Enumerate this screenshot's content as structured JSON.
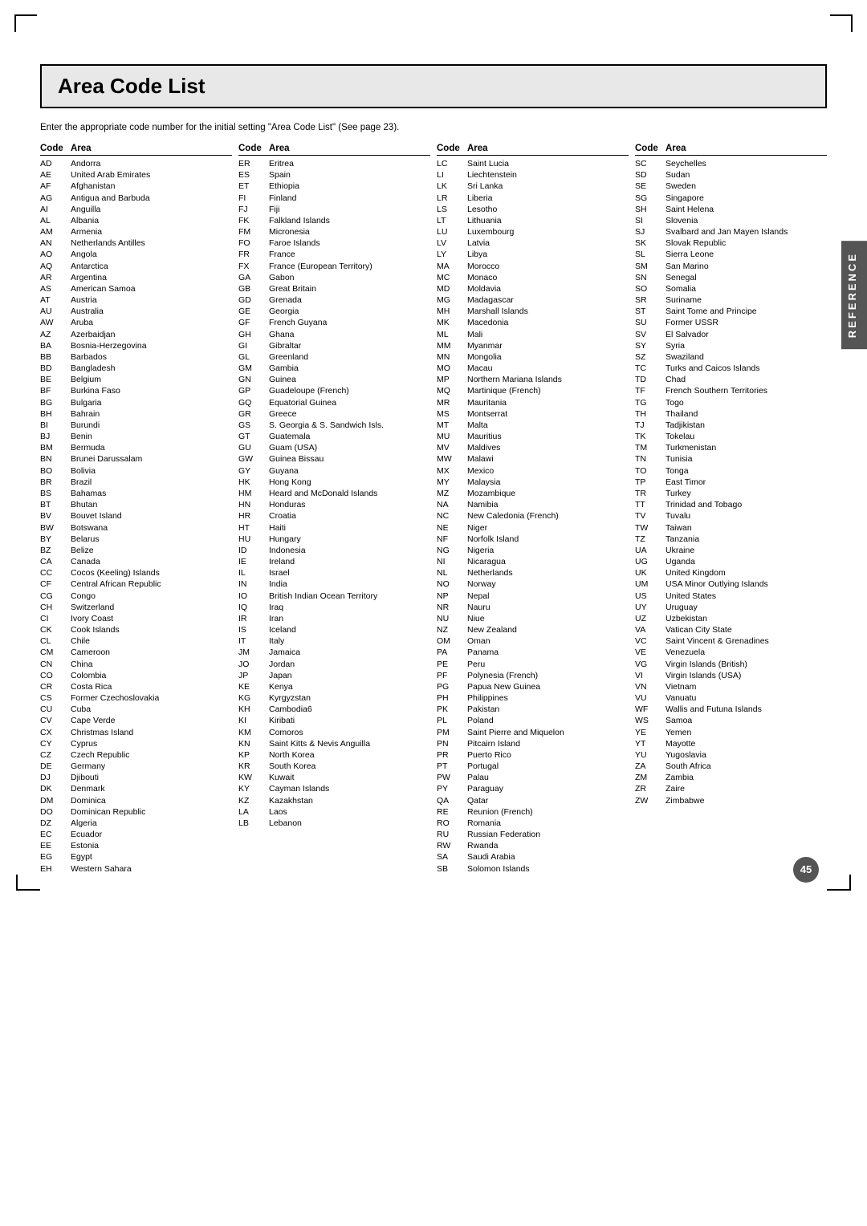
{
  "page": {
    "title": "Area Code List",
    "subtitle": "Enter the appropriate code number for the initial setting \"Area Code List\" (See page 23).",
    "page_number": "45",
    "side_tab": "REFERENCE"
  },
  "columns": [
    {
      "header_code": "Code",
      "header_area": "Area",
      "entries": [
        {
          "code": "AD",
          "area": "Andorra"
        },
        {
          "code": "AE",
          "area": "United Arab Emirates"
        },
        {
          "code": "AF",
          "area": "Afghanistan"
        },
        {
          "code": "AG",
          "area": "Antigua and Barbuda"
        },
        {
          "code": "AI",
          "area": "Anguilla"
        },
        {
          "code": "AL",
          "area": "Albania"
        },
        {
          "code": "AM",
          "area": "Armenia"
        },
        {
          "code": "AN",
          "area": "Netherlands Antilles"
        },
        {
          "code": "AO",
          "area": "Angola"
        },
        {
          "code": "AQ",
          "area": "Antarctica"
        },
        {
          "code": "AR",
          "area": "Argentina"
        },
        {
          "code": "AS",
          "area": "American Samoa"
        },
        {
          "code": "AT",
          "area": "Austria"
        },
        {
          "code": "AU",
          "area": "Australia"
        },
        {
          "code": "AW",
          "area": "Aruba"
        },
        {
          "code": "AZ",
          "area": "Azerbaidjan"
        },
        {
          "code": "BA",
          "area": "Bosnia-Herzegovina"
        },
        {
          "code": "BB",
          "area": "Barbados"
        },
        {
          "code": "BD",
          "area": "Bangladesh"
        },
        {
          "code": "BE",
          "area": "Belgium"
        },
        {
          "code": "BF",
          "area": "Burkina Faso"
        },
        {
          "code": "BG",
          "area": "Bulgaria"
        },
        {
          "code": "BH",
          "area": "Bahrain"
        },
        {
          "code": "BI",
          "area": "Burundi"
        },
        {
          "code": "BJ",
          "area": "Benin"
        },
        {
          "code": "BM",
          "area": "Bermuda"
        },
        {
          "code": "BN",
          "area": "Brunei Darussalam"
        },
        {
          "code": "BO",
          "area": "Bolivia"
        },
        {
          "code": "BR",
          "area": "Brazil"
        },
        {
          "code": "BS",
          "area": "Bahamas"
        },
        {
          "code": "BT",
          "area": "Bhutan"
        },
        {
          "code": "BV",
          "area": "Bouvet Island"
        },
        {
          "code": "BW",
          "area": "Botswana"
        },
        {
          "code": "BY",
          "area": "Belarus"
        },
        {
          "code": "BZ",
          "area": "Belize"
        },
        {
          "code": "CA",
          "area": "Canada"
        },
        {
          "code": "CC",
          "area": "Cocos (Keeling) Islands"
        },
        {
          "code": "CF",
          "area": "Central African Republic"
        },
        {
          "code": "CG",
          "area": "Congo"
        },
        {
          "code": "CH",
          "area": "Switzerland"
        },
        {
          "code": "CI",
          "area": "Ivory Coast"
        },
        {
          "code": "CK",
          "area": "Cook Islands"
        },
        {
          "code": "CL",
          "area": "Chile"
        },
        {
          "code": "CM",
          "area": "Cameroon"
        },
        {
          "code": "CN",
          "area": "China"
        },
        {
          "code": "CO",
          "area": "Colombia"
        },
        {
          "code": "CR",
          "area": "Costa Rica"
        },
        {
          "code": "CS",
          "area": "Former Czechoslovakia"
        },
        {
          "code": "CU",
          "area": "Cuba"
        },
        {
          "code": "CV",
          "area": "Cape Verde"
        },
        {
          "code": "CX",
          "area": "Christmas Island"
        },
        {
          "code": "CY",
          "area": "Cyprus"
        },
        {
          "code": "CZ",
          "area": "Czech Republic"
        },
        {
          "code": "DE",
          "area": "Germany"
        },
        {
          "code": "DJ",
          "area": "Djibouti"
        },
        {
          "code": "DK",
          "area": "Denmark"
        },
        {
          "code": "DM",
          "area": "Dominica"
        },
        {
          "code": "DO",
          "area": "Dominican Republic"
        },
        {
          "code": "DZ",
          "area": "Algeria"
        },
        {
          "code": "EC",
          "area": "Ecuador"
        },
        {
          "code": "EE",
          "area": "Estonia"
        },
        {
          "code": "EG",
          "area": "Egypt"
        },
        {
          "code": "EH",
          "area": "Western Sahara"
        }
      ]
    },
    {
      "header_code": "Code",
      "header_area": "Area",
      "entries": [
        {
          "code": "ER",
          "area": "Eritrea"
        },
        {
          "code": "ES",
          "area": "Spain"
        },
        {
          "code": "ET",
          "area": "Ethiopia"
        },
        {
          "code": "FI",
          "area": "Finland"
        },
        {
          "code": "FJ",
          "area": "Fiji"
        },
        {
          "code": "FK",
          "area": "Falkland Islands"
        },
        {
          "code": "FM",
          "area": "Micronesia"
        },
        {
          "code": "FO",
          "area": "Faroe Islands"
        },
        {
          "code": "FR",
          "area": "France"
        },
        {
          "code": "FX",
          "area": "France (European Territory)"
        },
        {
          "code": "GA",
          "area": "Gabon"
        },
        {
          "code": "GB",
          "area": "Great Britain"
        },
        {
          "code": "GD",
          "area": "Grenada"
        },
        {
          "code": "GE",
          "area": "Georgia"
        },
        {
          "code": "GF",
          "area": "French Guyana"
        },
        {
          "code": "GH",
          "area": "Ghana"
        },
        {
          "code": "GI",
          "area": "Gibraltar"
        },
        {
          "code": "GL",
          "area": "Greenland"
        },
        {
          "code": "GM",
          "area": "Gambia"
        },
        {
          "code": "GN",
          "area": "Guinea"
        },
        {
          "code": "GP",
          "area": "Guadeloupe (French)"
        },
        {
          "code": "GQ",
          "area": "Equatorial Guinea"
        },
        {
          "code": "GR",
          "area": "Greece"
        },
        {
          "code": "GS",
          "area": "S. Georgia & S. Sandwich Isls."
        },
        {
          "code": "GT",
          "area": "Guatemala"
        },
        {
          "code": "GU",
          "area": "Guam (USA)"
        },
        {
          "code": "GW",
          "area": "Guinea Bissau"
        },
        {
          "code": "GY",
          "area": "Guyana"
        },
        {
          "code": "HK",
          "area": "Hong Kong"
        },
        {
          "code": "HM",
          "area": "Heard and McDonald Islands"
        },
        {
          "code": "HN",
          "area": "Honduras"
        },
        {
          "code": "HR",
          "area": "Croatia"
        },
        {
          "code": "HT",
          "area": "Haiti"
        },
        {
          "code": "HU",
          "area": "Hungary"
        },
        {
          "code": "ID",
          "area": "Indonesia"
        },
        {
          "code": "IE",
          "area": "Ireland"
        },
        {
          "code": "IL",
          "area": "Israel"
        },
        {
          "code": "IN",
          "area": "India"
        },
        {
          "code": "IO",
          "area": "British Indian Ocean Territory"
        },
        {
          "code": "IQ",
          "area": "Iraq"
        },
        {
          "code": "IR",
          "area": "Iran"
        },
        {
          "code": "IS",
          "area": "Iceland"
        },
        {
          "code": "IT",
          "area": "Italy"
        },
        {
          "code": "JM",
          "area": "Jamaica"
        },
        {
          "code": "JO",
          "area": "Jordan"
        },
        {
          "code": "JP",
          "area": "Japan"
        },
        {
          "code": "KE",
          "area": "Kenya"
        },
        {
          "code": "KG",
          "area": "Kyrgyzstan"
        },
        {
          "code": "KH",
          "area": "Cambodia6"
        },
        {
          "code": "KI",
          "area": "Kiribati"
        },
        {
          "code": "KM",
          "area": "Comoros"
        },
        {
          "code": "KN",
          "area": "Saint Kitts & Nevis Anguilla"
        },
        {
          "code": "KP",
          "area": "North Korea"
        },
        {
          "code": "KR",
          "area": "South Korea"
        },
        {
          "code": "KW",
          "area": "Kuwait"
        },
        {
          "code": "KY",
          "area": "Cayman Islands"
        },
        {
          "code": "KZ",
          "area": "Kazakhstan"
        },
        {
          "code": "LA",
          "area": "Laos"
        },
        {
          "code": "LB",
          "area": "Lebanon"
        }
      ]
    },
    {
      "header_code": "Code",
      "header_area": "Area",
      "entries": [
        {
          "code": "LC",
          "area": "Saint Lucia"
        },
        {
          "code": "LI",
          "area": "Liechtenstein"
        },
        {
          "code": "LK",
          "area": "Sri Lanka"
        },
        {
          "code": "LR",
          "area": "Liberia"
        },
        {
          "code": "LS",
          "area": "Lesotho"
        },
        {
          "code": "LT",
          "area": "Lithuania"
        },
        {
          "code": "LU",
          "area": "Luxembourg"
        },
        {
          "code": "LV",
          "area": "Latvia"
        },
        {
          "code": "LY",
          "area": "Libya"
        },
        {
          "code": "MA",
          "area": "Morocco"
        },
        {
          "code": "MC",
          "area": "Monaco"
        },
        {
          "code": "MD",
          "area": "Moldavia"
        },
        {
          "code": "MG",
          "area": "Madagascar"
        },
        {
          "code": "MH",
          "area": "Marshall Islands"
        },
        {
          "code": "MK",
          "area": "Macedonia"
        },
        {
          "code": "ML",
          "area": "Mali"
        },
        {
          "code": "MM",
          "area": "Myanmar"
        },
        {
          "code": "MN",
          "area": "Mongolia"
        },
        {
          "code": "MO",
          "area": "Macau"
        },
        {
          "code": "MP",
          "area": "Northern Mariana Islands"
        },
        {
          "code": "MQ",
          "area": "Martinique (French)"
        },
        {
          "code": "MR",
          "area": "Mauritania"
        },
        {
          "code": "MS",
          "area": "Montserrat"
        },
        {
          "code": "MT",
          "area": "Malta"
        },
        {
          "code": "MU",
          "area": "Mauritius"
        },
        {
          "code": "MV",
          "area": "Maldives"
        },
        {
          "code": "MW",
          "area": "Malawi"
        },
        {
          "code": "MX",
          "area": "Mexico"
        },
        {
          "code": "MY",
          "area": "Malaysia"
        },
        {
          "code": "MZ",
          "area": "Mozambique"
        },
        {
          "code": "NA",
          "area": "Namibia"
        },
        {
          "code": "NC",
          "area": "New Caledonia (French)"
        },
        {
          "code": "NE",
          "area": "Niger"
        },
        {
          "code": "NF",
          "area": "Norfolk Island"
        },
        {
          "code": "NG",
          "area": "Nigeria"
        },
        {
          "code": "NI",
          "area": "Nicaragua"
        },
        {
          "code": "NL",
          "area": "Netherlands"
        },
        {
          "code": "NO",
          "area": "Norway"
        },
        {
          "code": "NP",
          "area": "Nepal"
        },
        {
          "code": "NR",
          "area": "Nauru"
        },
        {
          "code": "NU",
          "area": "Niue"
        },
        {
          "code": "NZ",
          "area": "New Zealand"
        },
        {
          "code": "OM",
          "area": "Oman"
        },
        {
          "code": "PA",
          "area": "Panama"
        },
        {
          "code": "PE",
          "area": "Peru"
        },
        {
          "code": "PF",
          "area": "Polynesia (French)"
        },
        {
          "code": "PG",
          "area": "Papua New Guinea"
        },
        {
          "code": "PH",
          "area": "Philippines"
        },
        {
          "code": "PK",
          "area": "Pakistan"
        },
        {
          "code": "PL",
          "area": "Poland"
        },
        {
          "code": "PM",
          "area": "Saint Pierre and Miquelon"
        },
        {
          "code": "PN",
          "area": "Pitcairn Island"
        },
        {
          "code": "PR",
          "area": "Puerto Rico"
        },
        {
          "code": "PT",
          "area": "Portugal"
        },
        {
          "code": "PW",
          "area": "Palau"
        },
        {
          "code": "PY",
          "area": "Paraguay"
        },
        {
          "code": "QA",
          "area": "Qatar"
        },
        {
          "code": "RE",
          "area": "Reunion (French)"
        },
        {
          "code": "RO",
          "area": "Romania"
        },
        {
          "code": "RU",
          "area": "Russian Federation"
        },
        {
          "code": "RW",
          "area": "Rwanda"
        },
        {
          "code": "SA",
          "area": "Saudi Arabia"
        },
        {
          "code": "SB",
          "area": "Solomon Islands"
        }
      ]
    },
    {
      "header_code": "Code",
      "header_area": "Area",
      "entries": [
        {
          "code": "SC",
          "area": "Seychelles"
        },
        {
          "code": "SD",
          "area": "Sudan"
        },
        {
          "code": "SE",
          "area": "Sweden"
        },
        {
          "code": "SG",
          "area": "Singapore"
        },
        {
          "code": "SH",
          "area": "Saint Helena"
        },
        {
          "code": "SI",
          "area": "Slovenia"
        },
        {
          "code": "SJ",
          "area": "Svalbard and Jan Mayen Islands"
        },
        {
          "code": "SK",
          "area": "Slovak Republic"
        },
        {
          "code": "SL",
          "area": "Sierra Leone"
        },
        {
          "code": "SM",
          "area": "San Marino"
        },
        {
          "code": "SN",
          "area": "Senegal"
        },
        {
          "code": "SO",
          "area": "Somalia"
        },
        {
          "code": "SR",
          "area": "Suriname"
        },
        {
          "code": "ST",
          "area": "Saint Tome and Principe"
        },
        {
          "code": "SU",
          "area": "Former USSR"
        },
        {
          "code": "SV",
          "area": "El Salvador"
        },
        {
          "code": "SY",
          "area": "Syria"
        },
        {
          "code": "SZ",
          "area": "Swaziland"
        },
        {
          "code": "TC",
          "area": "Turks and Caicos Islands"
        },
        {
          "code": "TD",
          "area": "Chad"
        },
        {
          "code": "TF",
          "area": "French Southern Territories"
        },
        {
          "code": "TG",
          "area": "Togo"
        },
        {
          "code": "TH",
          "area": "Thailand"
        },
        {
          "code": "TJ",
          "area": "Tadjikistan"
        },
        {
          "code": "TK",
          "area": "Tokelau"
        },
        {
          "code": "TM",
          "area": "Turkmenistan"
        },
        {
          "code": "TN",
          "area": "Tunisia"
        },
        {
          "code": "TO",
          "area": "Tonga"
        },
        {
          "code": "TP",
          "area": "East Timor"
        },
        {
          "code": "TR",
          "area": "Turkey"
        },
        {
          "code": "TT",
          "area": "Trinidad and Tobago"
        },
        {
          "code": "TV",
          "area": "Tuvalu"
        },
        {
          "code": "TW",
          "area": "Taiwan"
        },
        {
          "code": "TZ",
          "area": "Tanzania"
        },
        {
          "code": "UA",
          "area": "Ukraine"
        },
        {
          "code": "UG",
          "area": "Uganda"
        },
        {
          "code": "UK",
          "area": "United Kingdom"
        },
        {
          "code": "UM",
          "area": "USA Minor Outlying Islands"
        },
        {
          "code": "US",
          "area": "United States"
        },
        {
          "code": "UY",
          "area": "Uruguay"
        },
        {
          "code": "UZ",
          "area": "Uzbekistan"
        },
        {
          "code": "VA",
          "area": "Vatican City State"
        },
        {
          "code": "VC",
          "area": "Saint Vincent & Grenadines"
        },
        {
          "code": "VE",
          "area": "Venezuela"
        },
        {
          "code": "VG",
          "area": "Virgin Islands (British)"
        },
        {
          "code": "VI",
          "area": "Virgin Islands (USA)"
        },
        {
          "code": "VN",
          "area": "Vietnam"
        },
        {
          "code": "VU",
          "area": "Vanuatu"
        },
        {
          "code": "WF",
          "area": "Wallis and Futuna Islands"
        },
        {
          "code": "WS",
          "area": "Samoa"
        },
        {
          "code": "YE",
          "area": "Yemen"
        },
        {
          "code": "YT",
          "area": "Mayotte"
        },
        {
          "code": "YU",
          "area": "Yugoslavia"
        },
        {
          "code": "ZA",
          "area": "South Africa"
        },
        {
          "code": "ZM",
          "area": "Zambia"
        },
        {
          "code": "ZR",
          "area": "Zaire"
        },
        {
          "code": "ZW",
          "area": "Zimbabwe"
        }
      ]
    }
  ]
}
